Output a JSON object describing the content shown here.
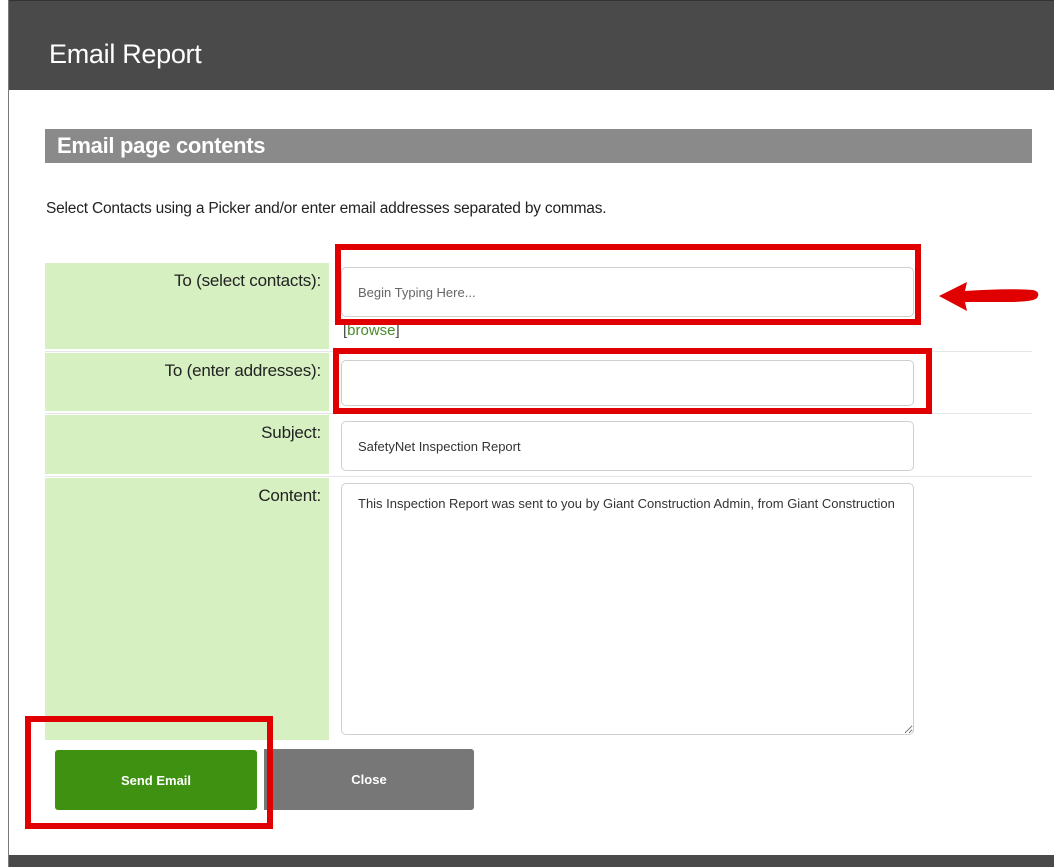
{
  "dialog": {
    "title": "Email Report"
  },
  "section": {
    "title": "Email page contents",
    "instructions": "Select Contacts using a Picker and/or enter email addresses separated by commas."
  },
  "form": {
    "to_contacts": {
      "label": "To (select contacts):",
      "placeholder": "Begin Typing Here...",
      "value": ""
    },
    "browse_link": "browse",
    "to_addresses": {
      "label": "To (enter addresses):",
      "value": ""
    },
    "subject": {
      "label": "Subject:",
      "value": "SafetyNet Inspection Report"
    },
    "content": {
      "label": "Content:",
      "value": "This Inspection Report was sent to you by Giant Construction Admin, from Giant Construction"
    }
  },
  "buttons": {
    "send_label": "Send Email",
    "close_label": "Close"
  },
  "colors": {
    "titlebar": "#4a4a4a",
    "section_header": "#8a8a8a",
    "label_bg": "#d6f0c2",
    "send_button": "#3e9111",
    "close_button": "#777777",
    "highlight": "#e10000"
  }
}
